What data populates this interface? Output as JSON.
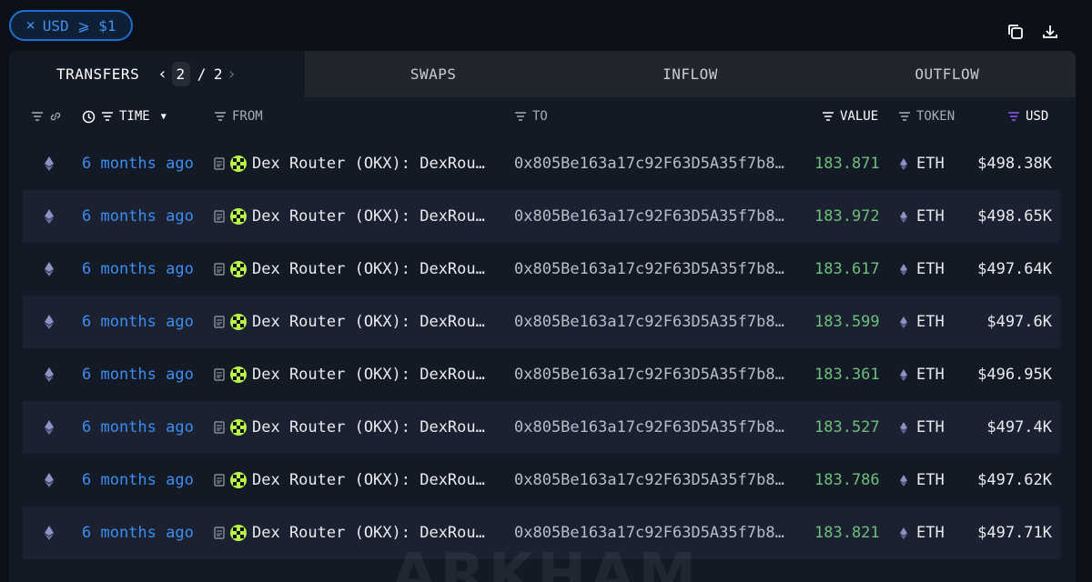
{
  "filter_chip": {
    "close": "×",
    "label": "USD ⩾ $1"
  },
  "top_icons": [
    "copy-icon",
    "download-icon"
  ],
  "tabs": {
    "transfers": "TRANSFERS",
    "pager": {
      "current": "2",
      "separator": "/",
      "total": "2"
    },
    "swaps": "SWAPS",
    "inflow": "INFLOW",
    "outflow": "OUTFLOW"
  },
  "columns": {
    "time": "TIME",
    "from": "FROM",
    "to": "TO",
    "value": "VALUE",
    "token": "TOKEN",
    "usd": "USD"
  },
  "rows": [
    {
      "time": "6 months ago",
      "from": "Dex Router (OKX): DexRou…",
      "to": "0x805Be163a17c92F63D5A35f7b8…",
      "value": "183.871",
      "token": "ETH",
      "usd": "$498.38K"
    },
    {
      "time": "6 months ago",
      "from": "Dex Router (OKX): DexRou…",
      "to": "0x805Be163a17c92F63D5A35f7b8…",
      "value": "183.972",
      "token": "ETH",
      "usd": "$498.65K"
    },
    {
      "time": "6 months ago",
      "from": "Dex Router (OKX): DexRou…",
      "to": "0x805Be163a17c92F63D5A35f7b8…",
      "value": "183.617",
      "token": "ETH",
      "usd": "$497.64K"
    },
    {
      "time": "6 months ago",
      "from": "Dex Router (OKX): DexRou…",
      "to": "0x805Be163a17c92F63D5A35f7b8…",
      "value": "183.599",
      "token": "ETH",
      "usd": "$497.6K"
    },
    {
      "time": "6 months ago",
      "from": "Dex Router (OKX): DexRou…",
      "to": "0x805Be163a17c92F63D5A35f7b8…",
      "value": "183.361",
      "token": "ETH",
      "usd": "$496.95K"
    },
    {
      "time": "6 months ago",
      "from": "Dex Router (OKX): DexRou…",
      "to": "0x805Be163a17c92F63D5A35f7b8…",
      "value": "183.527",
      "token": "ETH",
      "usd": "$497.4K"
    },
    {
      "time": "6 months ago",
      "from": "Dex Router (OKX): DexRou…",
      "to": "0x805Be163a17c92F63D5A35f7b8…",
      "value": "183.786",
      "token": "ETH",
      "usd": "$497.62K"
    },
    {
      "time": "6 months ago",
      "from": "Dex Router (OKX): DexRou…",
      "to": "0x805Be163a17c92F63D5A35f7b8…",
      "value": "183.821",
      "token": "ETH",
      "usd": "$497.71K"
    }
  ],
  "watermark": "ARKHAM",
  "colors": {
    "accent_blue": "#3b8ef0",
    "value_green": "#6cc07a",
    "usd_sort_purple": "#8b5cf6",
    "okx_lime": "#b7f34a",
    "background": "#0c1018"
  }
}
